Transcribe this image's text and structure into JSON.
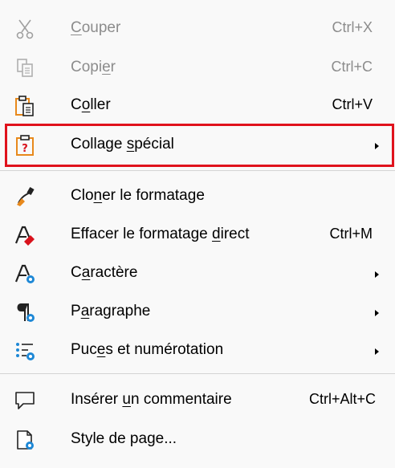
{
  "menu": {
    "items": [
      {
        "label_pre": "",
        "label_u": "C",
        "label_post": "ouper",
        "shortcut": "Ctrl+X",
        "icon": "scissors-icon",
        "disabled": true
      },
      {
        "label_pre": "Copi",
        "label_u": "e",
        "label_post": "r",
        "shortcut": "Ctrl+C",
        "icon": "copy-icon",
        "disabled": true
      },
      {
        "label_pre": "C",
        "label_u": "o",
        "label_post": "ller",
        "shortcut": "Ctrl+V",
        "icon": "paste-icon",
        "disabled": false
      },
      {
        "label_pre": "Collage ",
        "label_u": "s",
        "label_post": "pécial",
        "shortcut": "",
        "icon": "paste-special-icon",
        "submenu": true
      },
      {
        "label_pre": "Clo",
        "label_u": "n",
        "label_post": "er le formatage",
        "shortcut": "",
        "icon": "clone-formatting-icon"
      },
      {
        "label_pre": "Effacer le formatage ",
        "label_u": "d",
        "label_post": "irect",
        "shortcut": "Ctrl+M",
        "icon": "clear-formatting-icon"
      },
      {
        "label_pre": "C",
        "label_u": "a",
        "label_post": "ractère",
        "shortcut": "",
        "icon": "character-icon",
        "submenu": true
      },
      {
        "label_pre": "P",
        "label_u": "a",
        "label_post": "ragraphe",
        "shortcut": "",
        "icon": "paragraph-icon",
        "submenu": true
      },
      {
        "label_pre": "Puc",
        "label_u": "e",
        "label_post": "s et numérotation",
        "shortcut": "",
        "icon": "bullets-numbering-icon",
        "submenu": true
      },
      {
        "label_pre": "Insérer ",
        "label_u": "u",
        "label_post": "n commentaire",
        "shortcut": "Ctrl+Alt+C",
        "icon": "comment-icon"
      },
      {
        "label_pre": "Style de page...",
        "label_u": "",
        "label_post": "",
        "shortcut": "",
        "icon": "page-style-icon"
      }
    ]
  },
  "colors": {
    "highlight_border": "#e0121c",
    "disabled_text": "#8c8c8c",
    "accent_orange": "#e8891c",
    "accent_blue": "#1e88d6"
  }
}
